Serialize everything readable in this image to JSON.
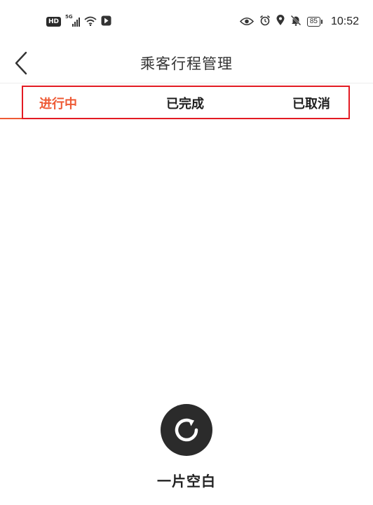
{
  "status_bar": {
    "badge": "HD",
    "network": "5G",
    "battery": "85",
    "time": "10:52",
    "icons": [
      "hd-icon",
      "signal-icon",
      "wifi-icon",
      "screen-cast-icon",
      "eye-icon",
      "alarm-icon",
      "location-icon",
      "mute-icon",
      "battery-icon"
    ]
  },
  "header": {
    "title": "乘客行程管理",
    "back_icon": "chevron-left-icon"
  },
  "tabs": [
    {
      "label": "进行中",
      "active": true
    },
    {
      "label": "已完成",
      "active": false
    },
    {
      "label": "已取消",
      "active": false
    }
  ],
  "empty_state": {
    "icon": "refresh-icon",
    "text": "一片空白"
  },
  "colors": {
    "accent": "#ee5a35",
    "highlight_box": "#e31b23",
    "empty_icon_bg": "#2b2b2b"
  }
}
